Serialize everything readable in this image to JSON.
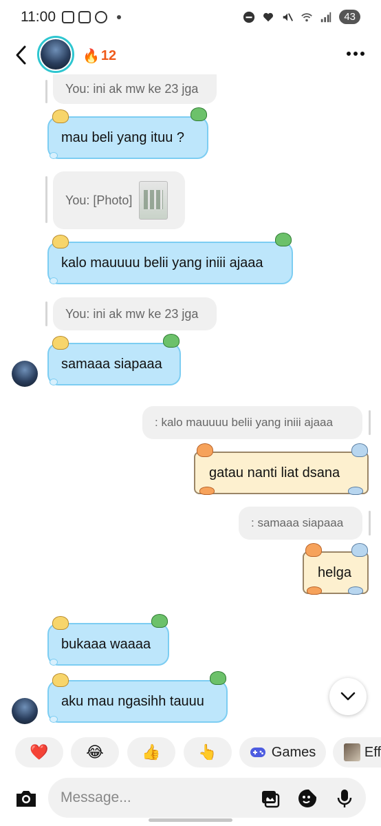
{
  "status_bar": {
    "time": "11:00",
    "battery": "43"
  },
  "header": {
    "streak_emoji": "🔥",
    "streak_count": "12"
  },
  "messages": {
    "q1": "You: ini ak mw ke 23 jga",
    "b1": "mau beli yang ituu ?",
    "q2": "You: [Photo]",
    "b2": "kalo mauuuu belii yang iniii ajaaa",
    "q3": "You: ini ak mw ke 23 jga",
    "b3": "samaaa siapaaa",
    "q4": ": kalo mauuuu belii yang iniii ajaaa",
    "b4": "gatau nanti liat dsana",
    "q5": ": samaaa siapaaa",
    "b5": "helga",
    "b6": "bukaaa waaaa",
    "b7": "aku mau ngasihh tauuu"
  },
  "reactions": {
    "heart": "❤️",
    "joy": "😂",
    "thumbs_up": "👍",
    "point": "👆",
    "games_label": "Games",
    "effects_label": "Eff"
  },
  "composer": {
    "placeholder": "Message..."
  }
}
